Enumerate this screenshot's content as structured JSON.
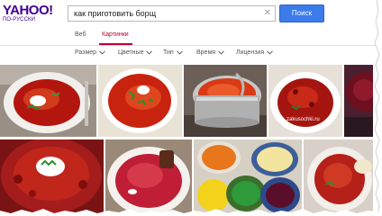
{
  "logo": {
    "main": "YAHOO!",
    "sub": "ПО-РУССКИ"
  },
  "search": {
    "value": "как приготовить борщ",
    "clear_symbol": "✕",
    "button_label": "Поиск"
  },
  "tabs": [
    {
      "label": "Веб",
      "active": false
    },
    {
      "label": "Картинки",
      "active": true
    }
  ],
  "filters": [
    {
      "label": "Размер"
    },
    {
      "label": "Цветные"
    },
    {
      "label": "Тип"
    },
    {
      "label": "Время"
    },
    {
      "label": "Лицензия"
    }
  ],
  "images": {
    "watermark": "zakusochki.ru",
    "items": [
      {
        "name": "borscht-plate-sour-cream"
      },
      {
        "name": "borscht-bowl-herbs"
      },
      {
        "name": "borscht-pot-ladle"
      },
      {
        "name": "borscht-white-bowl"
      },
      {
        "name": "borscht-dark-partial"
      },
      {
        "name": "borscht-sour-cream-dill"
      },
      {
        "name": "borscht-dark-bowl"
      },
      {
        "name": "borscht-ingredients"
      },
      {
        "name": "borscht-garlic-bread"
      }
    ]
  },
  "colors": {
    "accent": "#410093",
    "search_button": "#3b7bea",
    "active_tab": "#c00033"
  }
}
